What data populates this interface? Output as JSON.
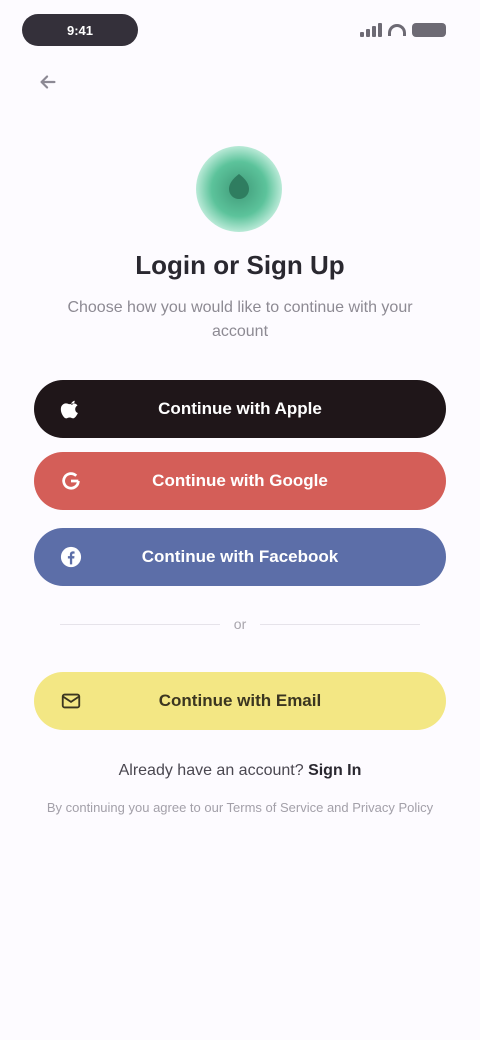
{
  "status_bar": {
    "time": "9:41"
  },
  "header": {
    "title": "Login or Sign Up",
    "subtitle": "Choose how you would like to continue with your account"
  },
  "buttons": {
    "apple": {
      "label": "Continue with Apple",
      "icon": "apple-icon"
    },
    "google": {
      "label": "Continue with Google",
      "icon": "google-icon"
    },
    "facebook": {
      "label": "Continue with Facebook",
      "icon": "facebook-icon"
    },
    "email": {
      "label": "Continue with Email",
      "icon": "mail-icon"
    }
  },
  "divider": {
    "label": "or"
  },
  "footer": {
    "signin_prompt": "Already have an account?",
    "signin_link": "Sign In",
    "terms": "By continuing you agree to our Terms of Service and Privacy Policy"
  },
  "colors": {
    "apple": "#1f1619",
    "google": "#d45e58",
    "facebook": "#5c6ea8",
    "email": "#f3e784",
    "brand": "#5cc39b"
  }
}
